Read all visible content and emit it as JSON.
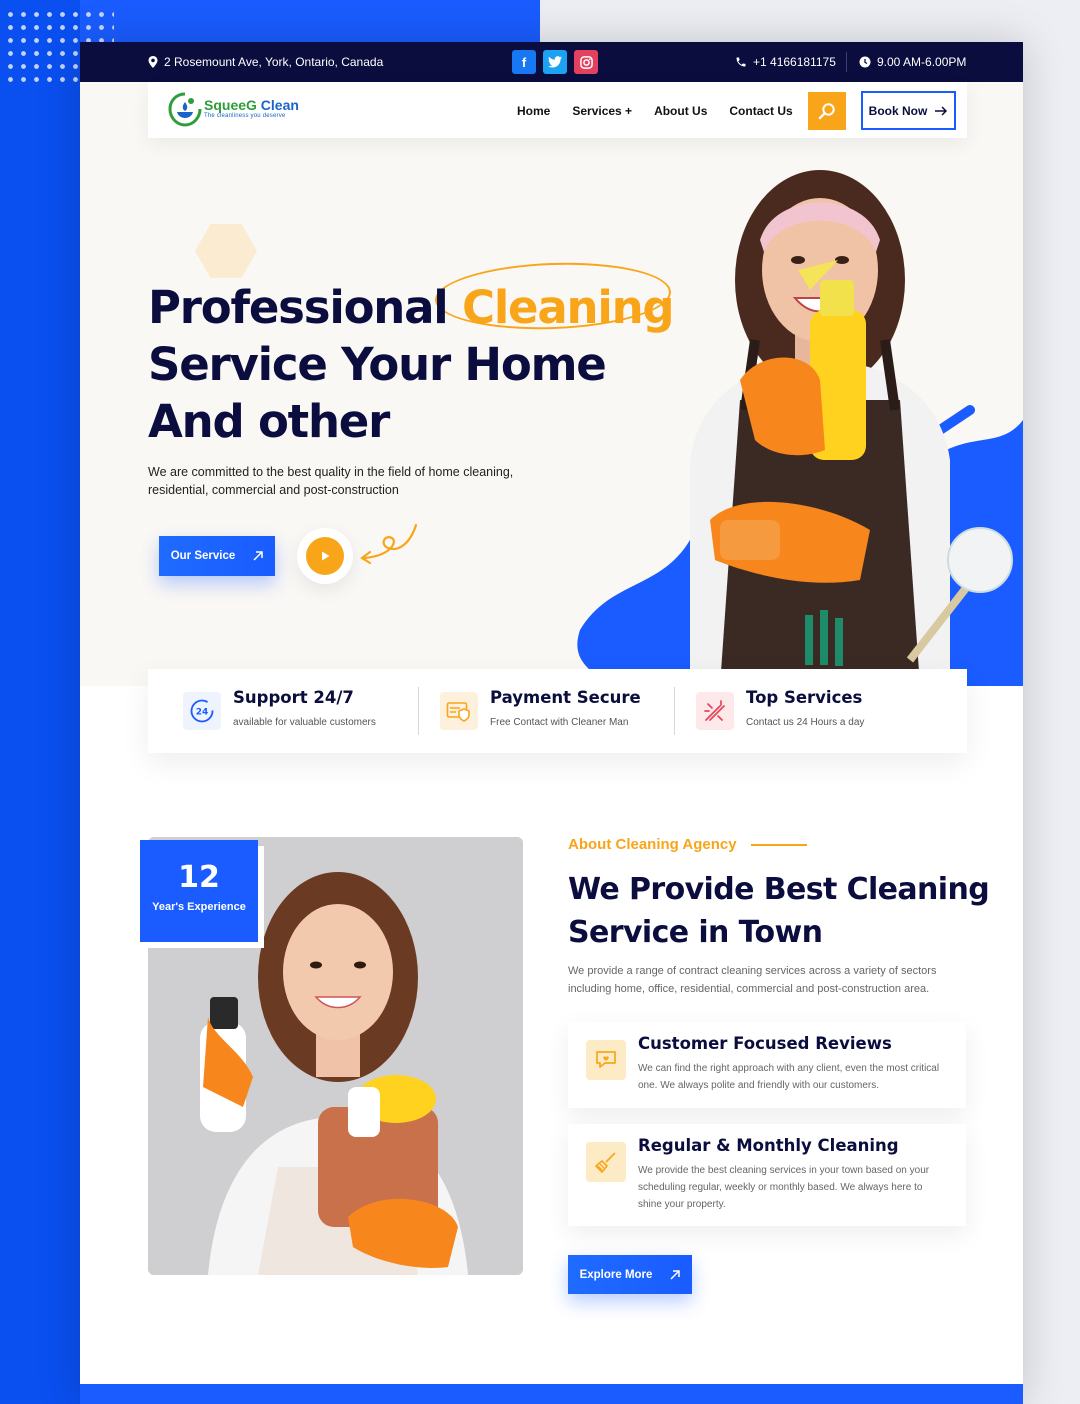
{
  "topbar": {
    "address": "2 Rosemount Ave, York, Ontario, Canada",
    "phone": "+1 4166181175",
    "hours": "9.00 AM-6.00PM",
    "socials": [
      {
        "icon": "facebook-icon",
        "glyph": "f"
      },
      {
        "icon": "twitter-icon",
        "glyph": "t"
      },
      {
        "icon": "instagram-icon",
        "glyph": "◎"
      }
    ]
  },
  "logo": {
    "name_part1": "SqueeG",
    "name_part2": " Clean",
    "tagline": "The cleanliness you deserve"
  },
  "nav": {
    "items": [
      "Home",
      "Services +",
      "About Us",
      "Contact Us"
    ],
    "book_label": "Book Now"
  },
  "hero": {
    "title_line1_a": "Professional ",
    "title_line1_b": "Cleaning",
    "title_line2": "Service Your Home",
    "title_line3": "And other",
    "description": "We are committed to the best quality in the field of home cleaning, residential, commercial and post-construction",
    "cta_label": "Our Service"
  },
  "features": [
    {
      "title": "Support 24/7",
      "subtitle": "available for valuable customers",
      "icon": "support-24-icon"
    },
    {
      "title": "Payment Secure",
      "subtitle": "Free Contact with Cleaner Man",
      "icon": "payment-secure-icon"
    },
    {
      "title": "Top Services",
      "subtitle": "Contact us 24 Hours a day",
      "icon": "top-services-icon"
    }
  ],
  "about": {
    "experience_number": "12",
    "experience_label": "Year's Experience",
    "tag": "About Cleaning Agency",
    "title_line1": "We Provide Best Cleaning",
    "title_line2": "Service in Town",
    "description": "We provide a range of contract cleaning services across a variety of sectors including home, office, residential, commercial and post-construction area.",
    "cards": [
      {
        "title": "Customer Focused Reviews",
        "description": "We can find the right approach with any client, even the most critical one. We always polite and friendly with our customers.",
        "icon": "review-chat-icon"
      },
      {
        "title": "Regular & Monthly Cleaning",
        "description": "We provide the best cleaning services in your town based on your scheduling regular, weekly or monthly based. We always here to shine your property.",
        "icon": "broom-icon"
      }
    ],
    "cta_label": "Explore More"
  },
  "colors": {
    "brand_blue": "#1a5cff",
    "accent_orange": "#f9a51a",
    "navy": "#0a0d3d"
  }
}
